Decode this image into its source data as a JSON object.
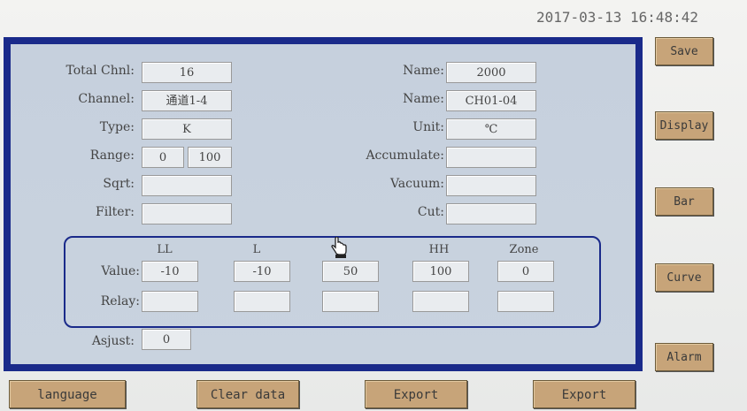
{
  "status": {
    "timestamp": "2017-03-13 16:48:42"
  },
  "form": {
    "total_chnl": {
      "label": "Total Chnl:",
      "value": "16"
    },
    "channel": {
      "label": "Channel:",
      "value": "通道1-4"
    },
    "type": {
      "label": "Type:",
      "value": "K"
    },
    "range": {
      "label": "Range:",
      "min": "0",
      "max": "100"
    },
    "sqrt": {
      "label": "Sqrt:",
      "value": ""
    },
    "filter": {
      "label": "Filter:",
      "value": ""
    },
    "name1": {
      "label": "Name:",
      "value": "2000"
    },
    "name2": {
      "label": "Name:",
      "value": "CH01-04"
    },
    "unit": {
      "label": "Unit:",
      "value": "℃"
    },
    "accumulate": {
      "label": "Accumulate:",
      "value": ""
    },
    "vacuum": {
      "label": "Vacuum:",
      "value": ""
    },
    "cut": {
      "label": "Cut:",
      "value": ""
    },
    "adjust": {
      "label": "Asjust:",
      "value": "0"
    }
  },
  "limits": {
    "headers": [
      "LL",
      "L",
      "",
      "HH",
      "Zone"
    ],
    "value_label": "Value:",
    "relay_label": "Relay:",
    "values": [
      "-10",
      "-10",
      "50",
      "100",
      "0"
    ],
    "relays": [
      "",
      "",
      "",
      "",
      ""
    ]
  },
  "side_buttons": [
    "Save",
    "Display",
    "Bar",
    "Curve",
    "Alarm"
  ],
  "bottom_buttons": [
    "language",
    "Clear data",
    "Export",
    "Export"
  ],
  "colors": {
    "frame": "#1a2a8a",
    "panel": "#c8d2de",
    "button": "#c7a479"
  }
}
